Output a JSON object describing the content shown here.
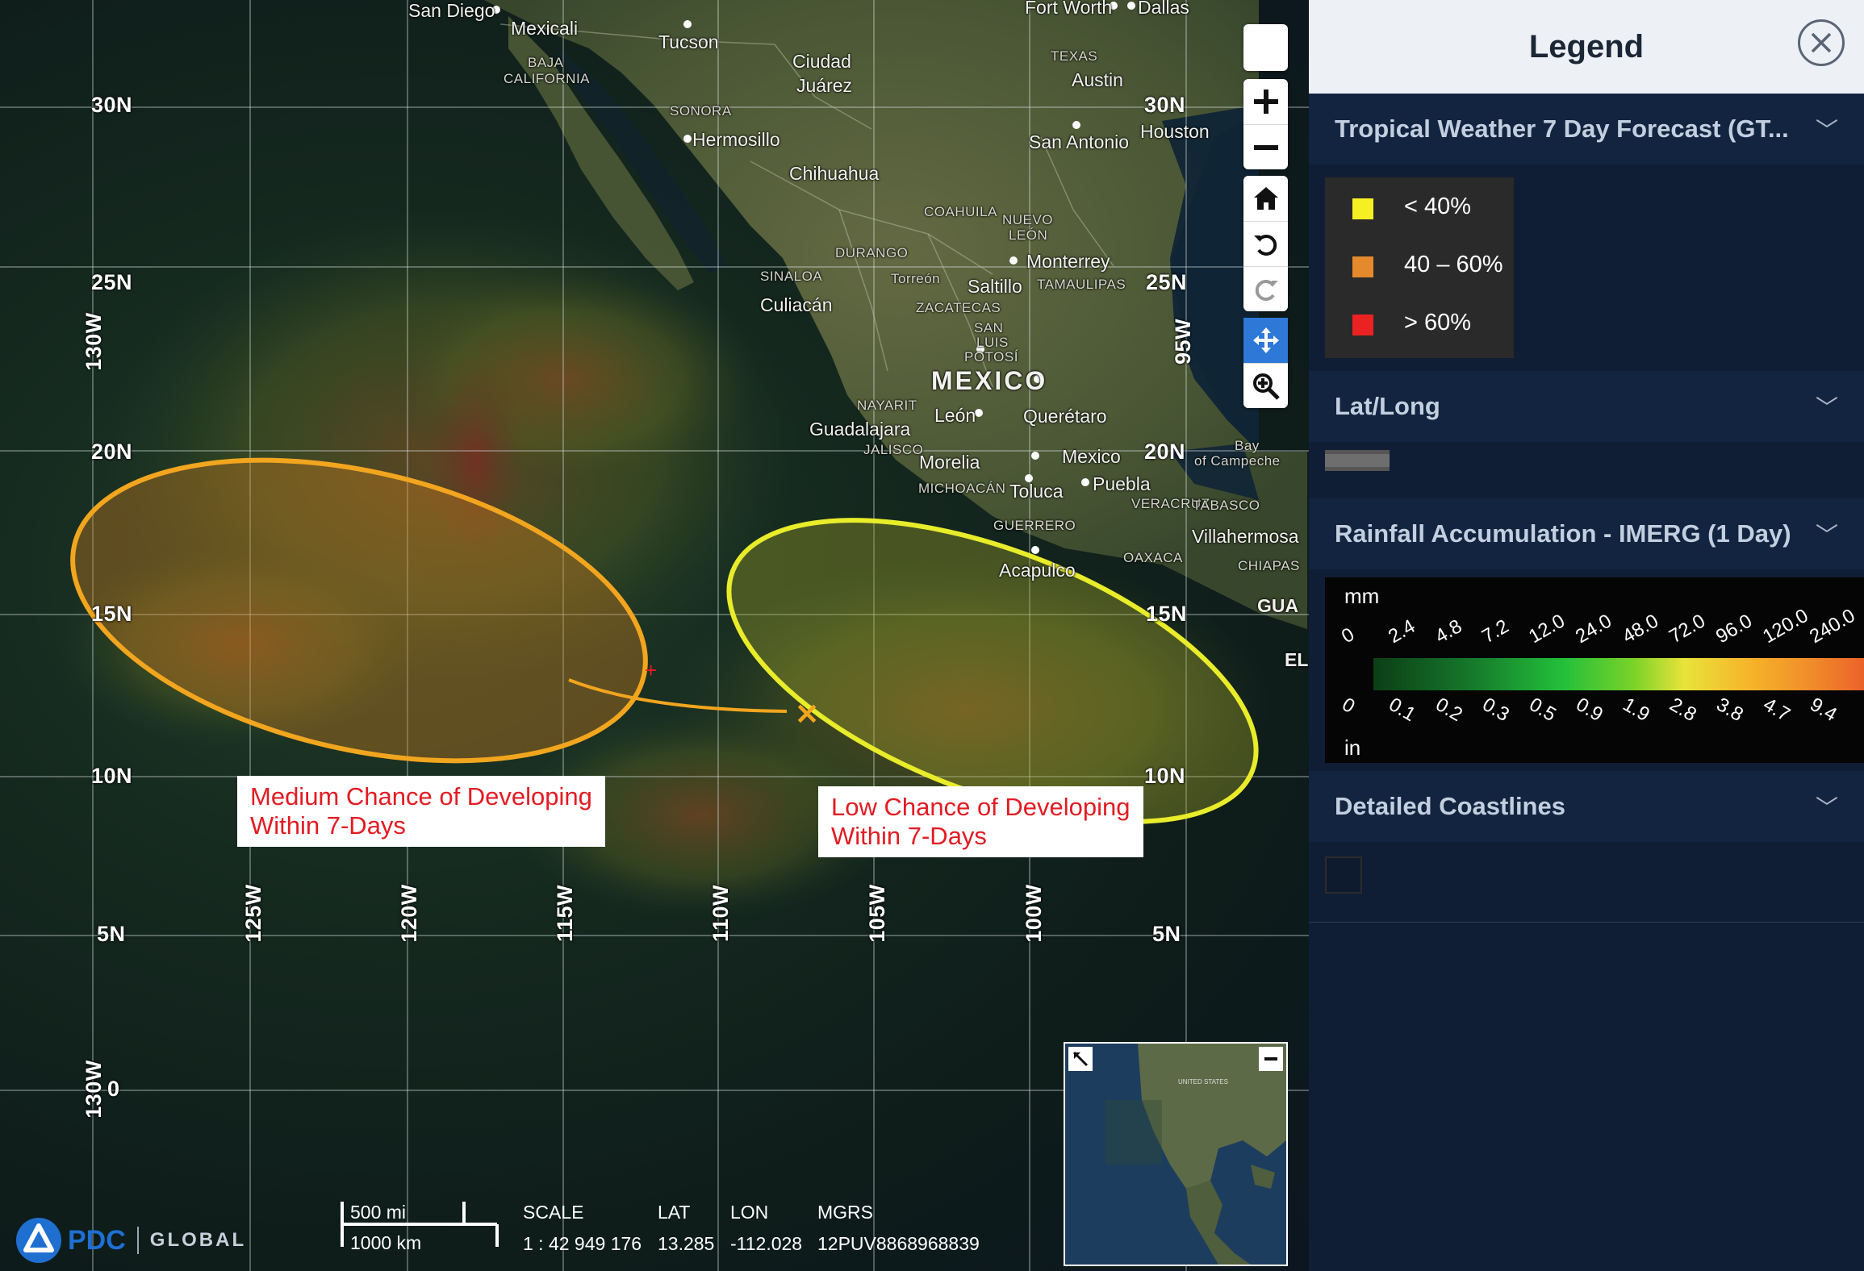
{
  "map": {
    "lat_labels": [
      "30N",
      "25N",
      "20N",
      "15N",
      "10N",
      "5N",
      "0"
    ],
    "lat_labels_right": [
      "30N",
      "25N",
      "20N",
      "15N",
      "10N",
      "5N"
    ],
    "lon_labels": [
      "130W",
      "125W",
      "120W",
      "115W",
      "110W",
      "105W",
      "100W",
      "95W",
      "130W"
    ],
    "places": {
      "san_diego": "San Diego",
      "mexicali": "Mexicali",
      "tucson": "Tucson",
      "fort_worth": "Fort Worth",
      "dallas": "Dallas",
      "baja": "BAJA",
      "california": "CALIFORNIA",
      "ciudad_juarez_1": "Ciudad",
      "ciudad_juarez_2": "Juárez",
      "texas": "TEXAS",
      "austin": "Austin",
      "sonora": "SONORA",
      "hermosillo": "Hermosillo",
      "houston": "Houston",
      "chihuahua": "Chihuahua",
      "san_antonio": "San Antonio",
      "coahuila": "COAHUILA",
      "nuevo_leon_1": "NUEVO",
      "nuevo_leon_2": "LEÓN",
      "durango": "DURANGO",
      "monterrey": "Monterrey",
      "sinaloa": "SINALOA",
      "torreon": "Torreón",
      "saltillo": "Saltillo",
      "tamaulipas": "TAMAULIPAS",
      "culiacan": "Culiacán",
      "zacatecas": "ZACATECAS",
      "slp_1": "SAN",
      "slp_2": "LUIS",
      "slp_3": "POTOSÍ",
      "mexico": "MEXICO",
      "nayarit": "NAYARIT",
      "leon": "León",
      "queretaro": "Querétaro",
      "guadalajara": "Guadalajara",
      "jalisco": "JALISCO",
      "morelia": "Morelia",
      "mexico_city": "Mexico",
      "bay_1": "Bay",
      "bay_2": "of Campeche",
      "michoacan": "MICHOACÁN",
      "toluca": "Toluca",
      "puebla": "Puebla",
      "veracruz": "VERACRUZ",
      "tabasco": "TABASCO",
      "guerrero": "GUERRERO",
      "oaxaca": "OAXACA",
      "villahermosa": "Villahermosa",
      "acapulco": "Acapulco",
      "chiapas": "CHIAPAS",
      "gua": "GUA",
      "el": "EL"
    },
    "annotations": {
      "medium": [
        "Medium Chance of Developing",
        "Within 7-Days"
      ],
      "low": [
        "Low Chance of Developing",
        "Within 7-Days"
      ]
    },
    "controls": [
      "blank",
      "zoom-in",
      "zoom-out",
      "home",
      "rotate-left",
      "rotate-right",
      "pan",
      "zoom-box"
    ],
    "scale_bar": {
      "mi": "500 mi",
      "km": "1000 km"
    },
    "info": {
      "scale_label": "SCALE",
      "scale_value": "1 : 42 949 176",
      "lat_label": "LAT",
      "lat_value": "13.285",
      "lon_label": "LON",
      "lon_value": "-112.028",
      "mgrs_label": "MGRS",
      "mgrs_value": "12PUV8868968839"
    },
    "logo": {
      "brand": "PDC",
      "product": "GLOBAL"
    },
    "overview_label": "UNITED STATES"
  },
  "legend": {
    "title": "Legend",
    "close_icon": "close-icon",
    "sections": {
      "tropical": {
        "title": "Tropical Weather 7 Day Forecast (GT...",
        "items": [
          {
            "label": "< 40%",
            "color": "#f6f023"
          },
          {
            "label": "40 – 60%",
            "color": "#e48a2c"
          },
          {
            "label": "> 60%",
            "color": "#ea2222"
          }
        ]
      },
      "latlong": {
        "title": "Lat/Long"
      },
      "rainfall": {
        "title": "Rainfall Accumulation - IMERG (1 Day)",
        "unit_mm": "mm",
        "unit_in": "in",
        "mm_ticks": [
          "0",
          "2.4",
          "4.8",
          "7.2",
          "12.0",
          "24.0",
          "48.0",
          "72.0",
          "96.0",
          "120.0",
          "240.0"
        ],
        "in_ticks": [
          "0",
          "0.1",
          "0.2",
          "0.3",
          "0.5",
          "0.9",
          "1.9",
          "2.8",
          "3.8",
          "4.7",
          "9.4"
        ]
      },
      "coastlines": {
        "title": "Detailed Coastlines"
      }
    }
  },
  "colors": {
    "medium_outline": "#f2a51e",
    "low_outline": "#e8ec2a",
    "annot_text": "#e31b23",
    "active_control": "#2e78d8"
  }
}
